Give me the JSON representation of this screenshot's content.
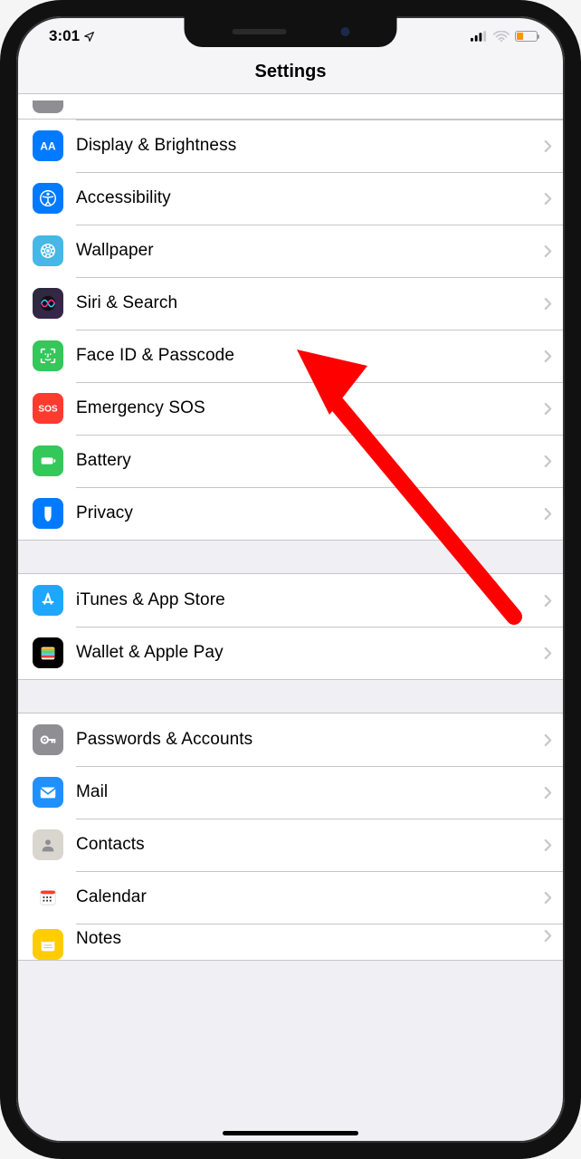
{
  "status": {
    "time": "3:01"
  },
  "header": {
    "title": "Settings"
  },
  "groups": [
    {
      "partial_first": true,
      "items": [
        {
          "id": "display",
          "label": "Display & Brightness",
          "icon": "display",
          "bg": "#007aff"
        },
        {
          "id": "accessibility",
          "label": "Accessibility",
          "icon": "accessibility",
          "bg": "#007aff"
        },
        {
          "id": "wallpaper",
          "label": "Wallpaper",
          "icon": "wallpaper",
          "bg": "#46b7e6"
        },
        {
          "id": "siri",
          "label": "Siri & Search",
          "icon": "siri",
          "bg": "grad"
        },
        {
          "id": "faceid",
          "label": "Face ID & Passcode",
          "icon": "faceid",
          "bg": "#34c759"
        },
        {
          "id": "sos",
          "label": "Emergency SOS",
          "icon": "sos",
          "bg": "#ff3b30"
        },
        {
          "id": "battery",
          "label": "Battery",
          "icon": "battery",
          "bg": "#34c759"
        },
        {
          "id": "privacy",
          "label": "Privacy",
          "icon": "privacy",
          "bg": "#007aff"
        }
      ]
    },
    {
      "items": [
        {
          "id": "itunes",
          "label": "iTunes & App Store",
          "icon": "appstore",
          "bg": "#1fa7ff"
        },
        {
          "id": "wallet",
          "label": "Wallet & Apple Pay",
          "icon": "wallet",
          "bg": "#000000"
        }
      ]
    },
    {
      "items": [
        {
          "id": "passwords",
          "label": "Passwords & Accounts",
          "icon": "key",
          "bg": "#8e8e93"
        },
        {
          "id": "mail",
          "label": "Mail",
          "icon": "mail",
          "bg": "#1e90ff"
        },
        {
          "id": "contacts",
          "label": "Contacts",
          "icon": "contacts",
          "bg": "#d8d6cf"
        },
        {
          "id": "calendar",
          "label": "Calendar",
          "icon": "calendar",
          "bg": "#ffffff"
        },
        {
          "id": "notes",
          "label": "Notes",
          "icon": "notes",
          "bg": "#ffcc00"
        }
      ]
    }
  ],
  "annotation": {
    "points_to": "faceid"
  }
}
